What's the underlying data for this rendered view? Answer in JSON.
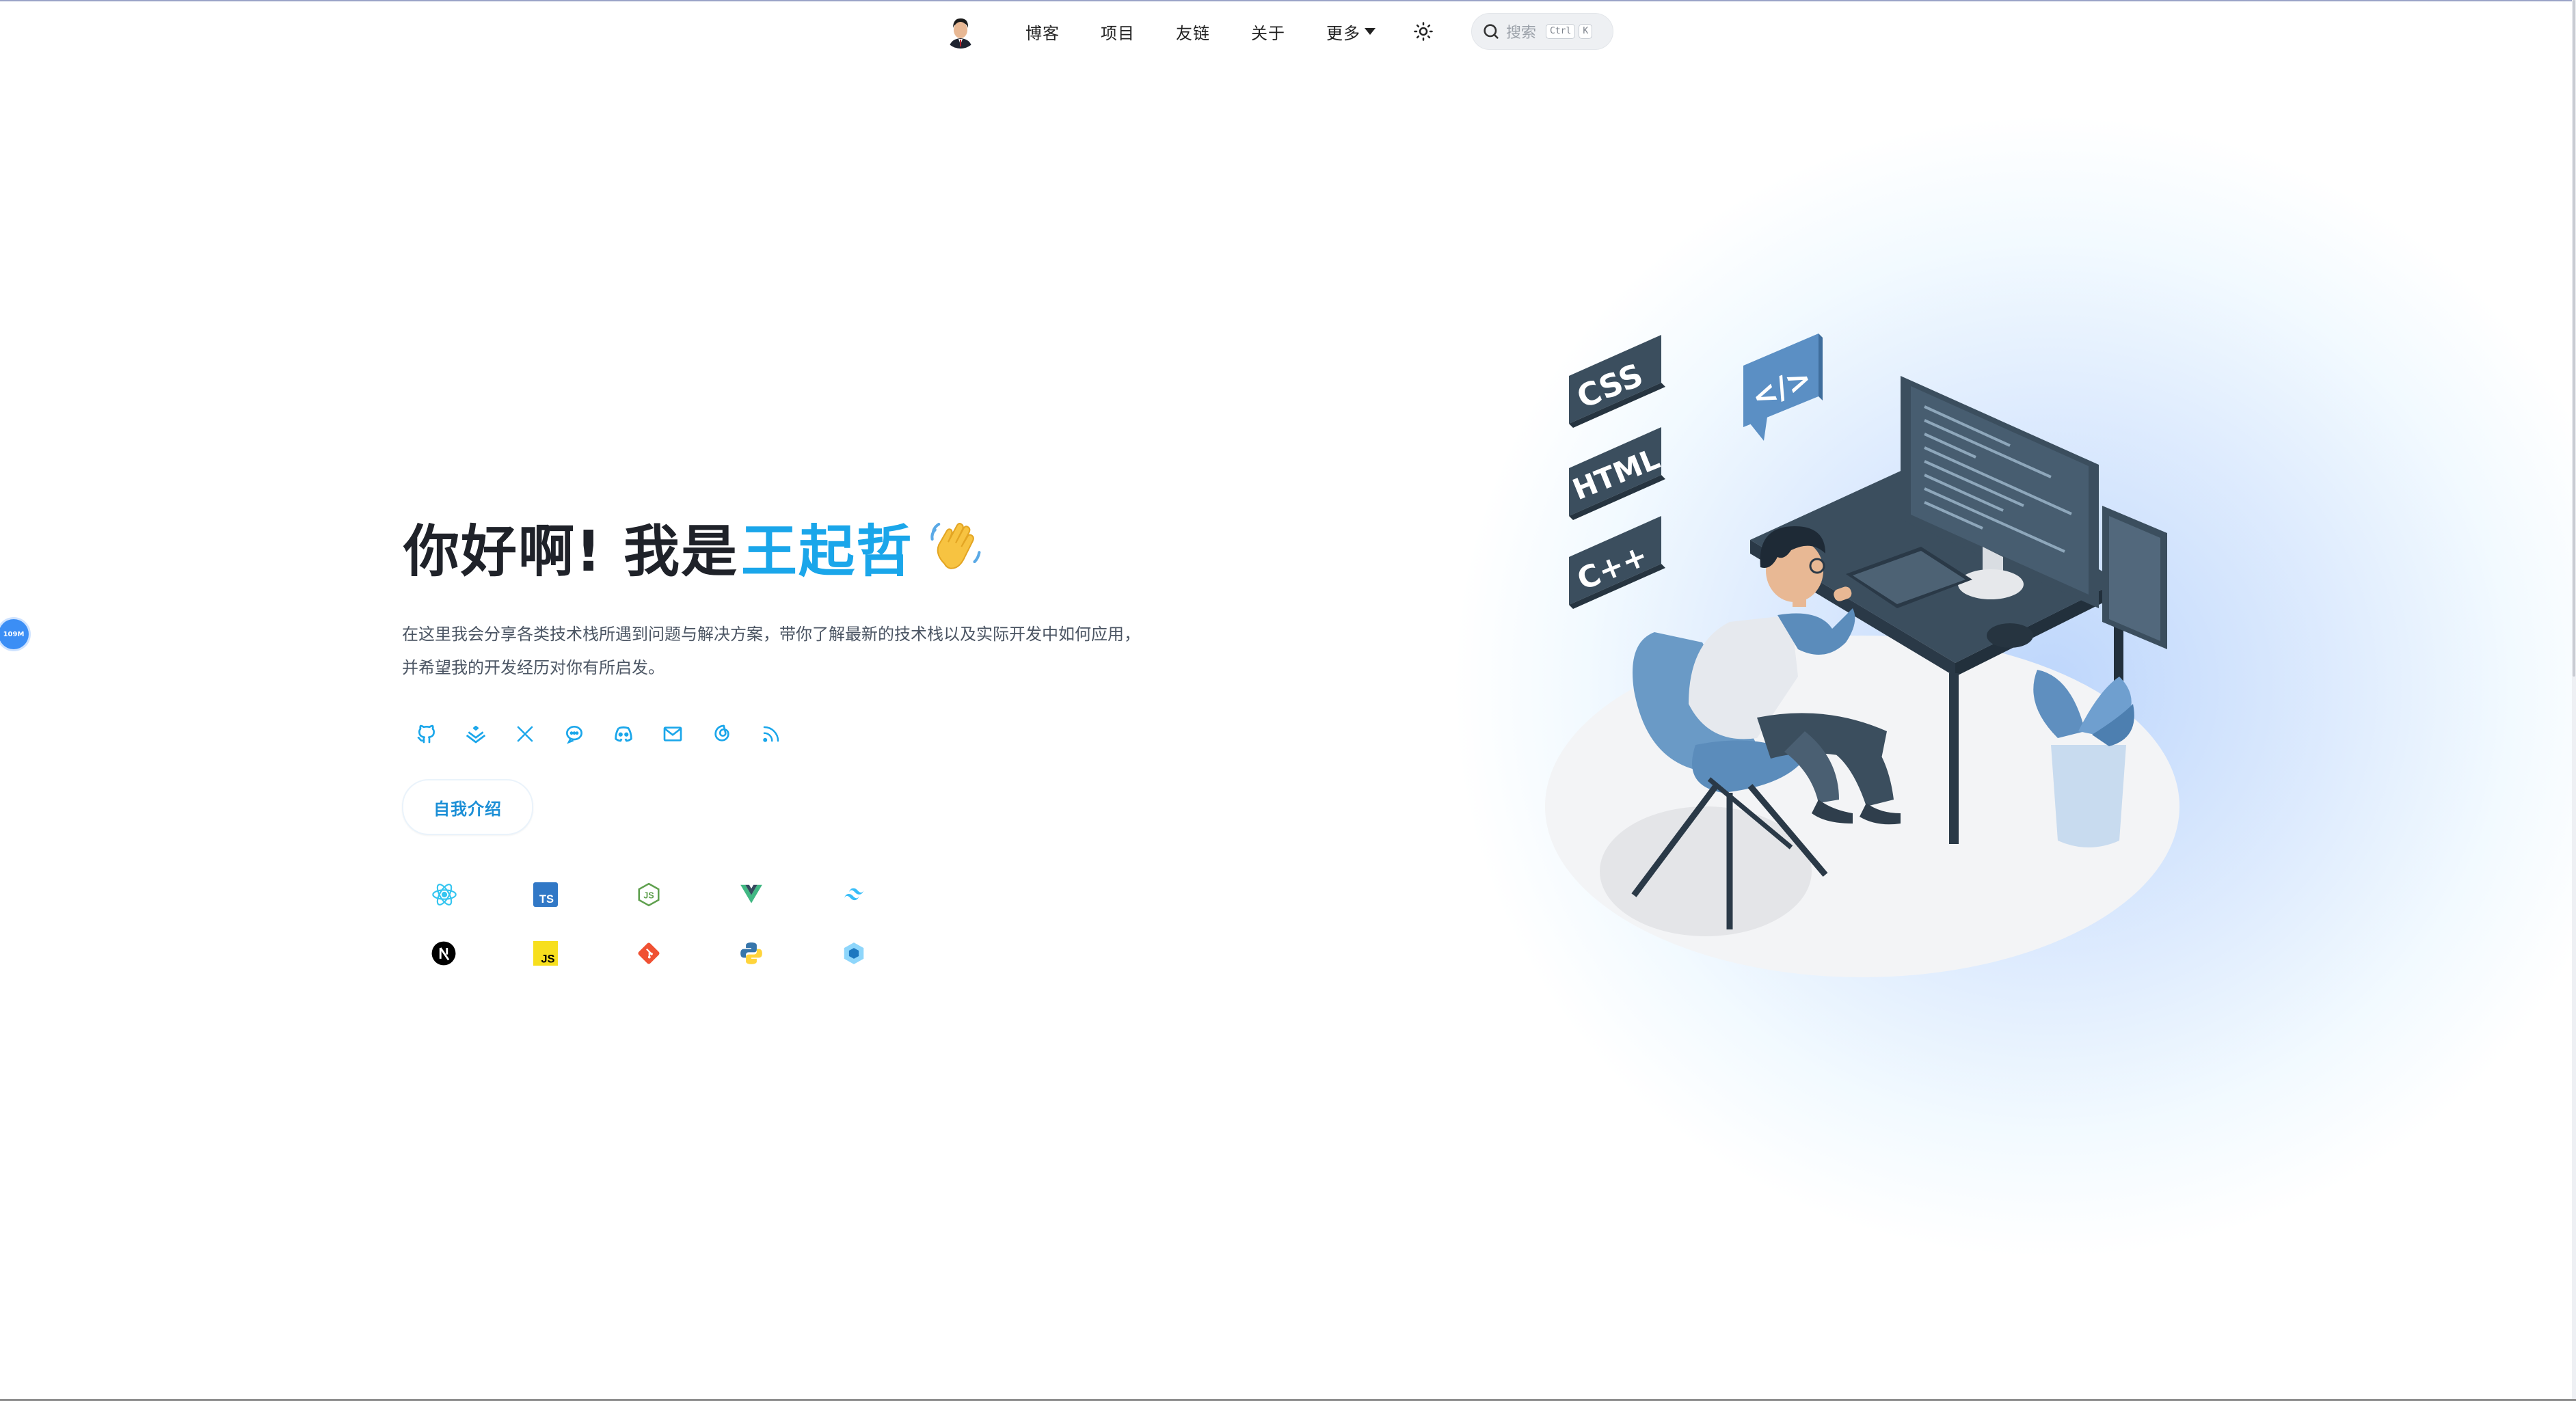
{
  "nav": {
    "items": [
      {
        "label": "博客"
      },
      {
        "label": "项目"
      },
      {
        "label": "友链"
      },
      {
        "label": "关于"
      },
      {
        "label": "更多"
      }
    ],
    "search": {
      "placeholder": "搜索",
      "shortcut_mod": "Ctrl",
      "shortcut_key": "K"
    }
  },
  "hero": {
    "greeting": "你好啊! 我是",
    "name": "王起哲",
    "description": "在这里我会分享各类技术栈所遇到问题与解决方案，带你了解最新的技术栈以及实际开发中如何应用，并希望我的开发经历对你有所启发。",
    "about_button": "自我介绍"
  },
  "socials": [
    "github-icon",
    "juejin-icon",
    "x-icon",
    "qq-icon",
    "discord-icon",
    "email-icon",
    "cloudmusic-icon",
    "rss-icon"
  ],
  "tech_stack": [
    "react-icon",
    "typescript-icon",
    "nodejs-icon",
    "vue-icon",
    "tailwind-icon",
    "nextjs-icon",
    "javascript-icon",
    "git-icon",
    "python-icon",
    "webpack-icon"
  ],
  "side_badge": "109M",
  "illustration_labels": {
    "css": "CSS",
    "html": "HTML",
    "cpp": "C++",
    "code": "</>"
  },
  "colors": {
    "accent": "#1aa6ea",
    "button_text": "#1c8fd6",
    "icon": "#1aa6ea"
  }
}
